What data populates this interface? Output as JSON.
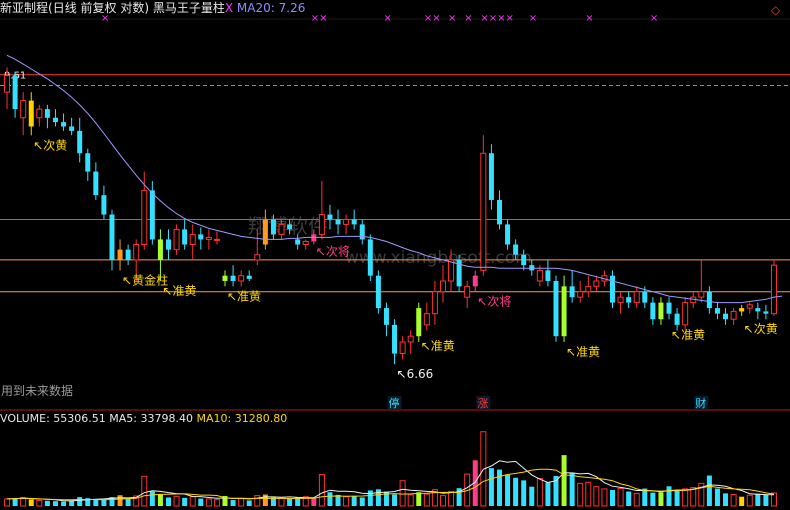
{
  "header": {
    "title": "新亚制程",
    "mode": "(日线 前复权 对数)",
    "indicator": "黑马王子量柱",
    "close_mark": "X",
    "ma20_label": "MA20:",
    "ma20_value": "7.26"
  },
  "volume_header": {
    "volume_label": "VOLUME:",
    "volume_value": "55306.51",
    "ma5_label": "MA5:",
    "ma5_value": "33798.40",
    "ma10_label": "MA10:",
    "ma10_value": "31280.80"
  },
  "watermark": {
    "cn": "翔博软件",
    "url": "www.xiangbosoft.com"
  },
  "footnote": "用到未来数据",
  "colors": {
    "up": "#ff3232",
    "down": "#33e0ff",
    "ma20": "#9b9bff",
    "hline_red": "#ff3c3c",
    "hline_green": "#2ed060",
    "hline_orange": "#ff9a50",
    "yellow": "#ffd700",
    "label_white": "#f0f0f0"
  },
  "chart_data": [
    {
      "type": "candlestick",
      "title": "新亚制程(日线 前复权 对数)",
      "indicator": "黑马王子量柱",
      "ma": {
        "name": "MA20",
        "last": 7.26
      },
      "price_range": [
        6.3,
        10.3
      ],
      "reference_levels": [
        {
          "value": 9.61,
          "label": "9.61",
          "color": "#ff3c3c"
        },
        {
          "value": 9.48,
          "color": "#2ed060",
          "style": "dashed"
        },
        {
          "value": 8.0,
          "color": "#ff3c3c"
        },
        {
          "value": 7.6,
          "color": "#ff9a50"
        },
        {
          "value": 7.3,
          "color": "#ff9a50"
        }
      ],
      "candles": [
        {
          "o": 9.4,
          "h": 9.7,
          "l": 9.2,
          "c": 9.6
        },
        {
          "o": 9.6,
          "h": 9.65,
          "l": 9.1,
          "c": 9.2
        },
        {
          "o": 9.1,
          "h": 9.4,
          "l": 8.9,
          "c": 9.3
        },
        {
          "o": 9.3,
          "h": 9.4,
          "l": 8.9,
          "c": 9.0,
          "special": "yellow"
        },
        {
          "o": 9.1,
          "h": 9.25,
          "l": 9.0,
          "c": 9.2
        },
        {
          "o": 9.2,
          "h": 9.25,
          "l": 8.98,
          "c": 9.1
        },
        {
          "o": 9.1,
          "h": 9.2,
          "l": 9.0,
          "c": 9.05
        },
        {
          "o": 9.05,
          "h": 9.15,
          "l": 8.95,
          "c": 9.0
        },
        {
          "o": 9.0,
          "h": 9.1,
          "l": 8.9,
          "c": 8.95
        },
        {
          "o": 8.95,
          "h": 9.1,
          "l": 8.6,
          "c": 8.7
        },
        {
          "o": 8.7,
          "h": 8.75,
          "l": 8.4,
          "c": 8.5
        },
        {
          "o": 8.5,
          "h": 8.6,
          "l": 8.2,
          "c": 8.25
        },
        {
          "o": 8.25,
          "h": 8.35,
          "l": 8.0,
          "c": 8.05
        },
        {
          "o": 8.05,
          "h": 8.1,
          "l": 7.5,
          "c": 7.6
        },
        {
          "o": 7.6,
          "h": 7.8,
          "l": 7.5,
          "c": 7.7,
          "special": "orange"
        },
        {
          "o": 7.7,
          "h": 7.75,
          "l": 7.55,
          "c": 7.6
        },
        {
          "o": 7.6,
          "h": 7.8,
          "l": 7.4,
          "c": 7.75
        },
        {
          "o": 7.75,
          "h": 8.5,
          "l": 7.7,
          "c": 8.3
        },
        {
          "o": 8.3,
          "h": 8.4,
          "l": 7.75,
          "c": 7.8
        },
        {
          "o": 7.6,
          "h": 7.9,
          "l": 7.4,
          "c": 7.8,
          "special": "lime"
        },
        {
          "o": 7.8,
          "h": 7.9,
          "l": 7.6,
          "c": 7.7
        },
        {
          "o": 7.7,
          "h": 7.95,
          "l": 7.65,
          "c": 7.9
        },
        {
          "o": 7.9,
          "h": 8.0,
          "l": 7.7,
          "c": 7.75
        },
        {
          "o": 7.75,
          "h": 7.95,
          "l": 7.6,
          "c": 7.85
        },
        {
          "o": 7.85,
          "h": 7.92,
          "l": 7.7,
          "c": 7.8
        },
        {
          "o": 7.8,
          "h": 7.9,
          "l": 7.7,
          "c": 7.82
        },
        {
          "o": 7.8,
          "h": 7.88,
          "l": 7.75,
          "c": 7.8
        },
        {
          "o": 7.4,
          "h": 7.5,
          "l": 7.35,
          "c": 7.45,
          "special": "lime"
        },
        {
          "o": 7.45,
          "h": 7.55,
          "l": 7.35,
          "c": 7.4
        },
        {
          "o": 7.4,
          "h": 7.5,
          "l": 7.35,
          "c": 7.45
        },
        {
          "o": 7.45,
          "h": 7.5,
          "l": 7.4,
          "c": 7.42
        },
        {
          "o": 7.6,
          "h": 7.9,
          "l": 7.55,
          "c": 7.65
        },
        {
          "o": 7.75,
          "h": 8.1,
          "l": 7.7,
          "c": 8.0,
          "special": "orange"
        },
        {
          "o": 8.0,
          "h": 8.05,
          "l": 7.8,
          "c": 7.85
        },
        {
          "o": 7.85,
          "h": 8.0,
          "l": 7.8,
          "c": 7.95
        },
        {
          "o": 7.95,
          "h": 8.0,
          "l": 7.85,
          "c": 7.9
        },
        {
          "o": 7.8,
          "h": 7.85,
          "l": 7.7,
          "c": 7.75
        },
        {
          "o": 7.75,
          "h": 7.8,
          "l": 7.7,
          "c": 7.78
        },
        {
          "o": 7.78,
          "h": 7.9,
          "l": 7.75,
          "c": 7.85,
          "special": "pink"
        },
        {
          "o": 7.85,
          "h": 8.4,
          "l": 7.8,
          "c": 8.05
        },
        {
          "o": 8.05,
          "h": 8.15,
          "l": 7.9,
          "c": 8.0
        },
        {
          "o": 8.0,
          "h": 8.1,
          "l": 7.85,
          "c": 7.95
        },
        {
          "o": 7.95,
          "h": 8.05,
          "l": 7.85,
          "c": 8.0
        },
        {
          "o": 8.0,
          "h": 8.1,
          "l": 7.9,
          "c": 7.95
        },
        {
          "o": 7.95,
          "h": 8.0,
          "l": 7.75,
          "c": 7.8
        },
        {
          "o": 7.8,
          "h": 7.85,
          "l": 7.4,
          "c": 7.45
        },
        {
          "o": 7.45,
          "h": 7.5,
          "l": 7.1,
          "c": 7.15
        },
        {
          "o": 7.15,
          "h": 7.2,
          "l": 6.9,
          "c": 7.0
        },
        {
          "o": 7.0,
          "h": 7.05,
          "l": 6.66,
          "c": 6.75
        },
        {
          "o": 6.75,
          "h": 6.9,
          "l": 6.7,
          "c": 6.85
        },
        {
          "o": 6.85,
          "h": 6.95,
          "l": 6.75,
          "c": 6.9
        },
        {
          "o": 6.9,
          "h": 7.2,
          "l": 6.85,
          "c": 7.15,
          "special": "lime"
        },
        {
          "o": 7.0,
          "h": 7.2,
          "l": 6.95,
          "c": 7.1
        },
        {
          "o": 7.1,
          "h": 7.4,
          "l": 7.0,
          "c": 7.3
        },
        {
          "o": 7.3,
          "h": 7.55,
          "l": 7.2,
          "c": 7.4
        },
        {
          "o": 7.4,
          "h": 7.7,
          "l": 7.3,
          "c": 7.6
        },
        {
          "o": 7.6,
          "h": 7.65,
          "l": 7.3,
          "c": 7.35
        },
        {
          "o": 7.25,
          "h": 7.4,
          "l": 7.15,
          "c": 7.35
        },
        {
          "o": 7.35,
          "h": 7.5,
          "l": 7.3,
          "c": 7.45,
          "special": "pink"
        },
        {
          "o": 7.5,
          "h": 8.9,
          "l": 7.45,
          "c": 8.7
        },
        {
          "o": 8.7,
          "h": 8.8,
          "l": 8.1,
          "c": 8.2
        },
        {
          "o": 8.2,
          "h": 8.3,
          "l": 7.9,
          "c": 7.95
        },
        {
          "o": 7.95,
          "h": 8.0,
          "l": 7.7,
          "c": 7.75
        },
        {
          "o": 7.75,
          "h": 7.8,
          "l": 7.6,
          "c": 7.65
        },
        {
          "o": 7.65,
          "h": 7.7,
          "l": 7.5,
          "c": 7.55
        },
        {
          "o": 7.55,
          "h": 7.6,
          "l": 7.45,
          "c": 7.5
        },
        {
          "o": 7.4,
          "h": 7.55,
          "l": 7.35,
          "c": 7.5
        },
        {
          "o": 7.5,
          "h": 7.6,
          "l": 7.35,
          "c": 7.4
        },
        {
          "o": 7.4,
          "h": 7.45,
          "l": 6.85,
          "c": 6.9
        },
        {
          "o": 6.9,
          "h": 7.45,
          "l": 6.85,
          "c": 7.35,
          "special": "lime"
        },
        {
          "o": 7.35,
          "h": 7.5,
          "l": 7.2,
          "c": 7.25
        },
        {
          "o": 7.25,
          "h": 7.4,
          "l": 7.2,
          "c": 7.3
        },
        {
          "o": 7.3,
          "h": 7.45,
          "l": 7.25,
          "c": 7.35
        },
        {
          "o": 7.35,
          "h": 7.45,
          "l": 7.3,
          "c": 7.4
        },
        {
          "o": 7.4,
          "h": 7.5,
          "l": 7.35,
          "c": 7.45
        },
        {
          "o": 7.45,
          "h": 7.5,
          "l": 7.15,
          "c": 7.2
        },
        {
          "o": 7.2,
          "h": 7.3,
          "l": 7.1,
          "c": 7.25
        },
        {
          "o": 7.25,
          "h": 7.3,
          "l": 7.15,
          "c": 7.2
        },
        {
          "o": 7.2,
          "h": 7.35,
          "l": 7.15,
          "c": 7.3
        },
        {
          "o": 7.3,
          "h": 7.35,
          "l": 7.15,
          "c": 7.2
        },
        {
          "o": 7.2,
          "h": 7.25,
          "l": 7.0,
          "c": 7.05
        },
        {
          "o": 7.05,
          "h": 7.25,
          "l": 7.0,
          "c": 7.2,
          "special": "lime"
        },
        {
          "o": 7.2,
          "h": 7.25,
          "l": 7.05,
          "c": 7.1
        },
        {
          "o": 7.1,
          "h": 7.15,
          "l": 6.95,
          "c": 7.0
        },
        {
          "o": 7.0,
          "h": 7.25,
          "l": 6.95,
          "c": 7.2
        },
        {
          "o": 7.2,
          "h": 7.3,
          "l": 7.15,
          "c": 7.25
        },
        {
          "o": 7.25,
          "h": 7.6,
          "l": 7.2,
          "c": 7.3
        },
        {
          "o": 7.3,
          "h": 7.35,
          "l": 7.1,
          "c": 7.15
        },
        {
          "o": 7.15,
          "h": 7.2,
          "l": 7.05,
          "c": 7.1
        },
        {
          "o": 7.1,
          "h": 7.15,
          "l": 7.0,
          "c": 7.05
        },
        {
          "o": 7.05,
          "h": 7.15,
          "l": 7.0,
          "c": 7.12
        },
        {
          "o": 7.12,
          "h": 7.18,
          "l": 7.08,
          "c": 7.15,
          "special": "yellow"
        },
        {
          "o": 7.15,
          "h": 7.2,
          "l": 7.1,
          "c": 7.18
        },
        {
          "o": 7.15,
          "h": 7.2,
          "l": 7.05,
          "c": 7.12
        },
        {
          "o": 7.12,
          "h": 7.18,
          "l": 7.05,
          "c": 7.1
        },
        {
          "o": 7.1,
          "h": 7.6,
          "l": 7.08,
          "c": 7.55
        }
      ],
      "ma20": [
        9.85,
        9.8,
        9.74,
        9.68,
        9.62,
        9.56,
        9.49,
        9.42,
        9.34,
        9.25,
        9.15,
        9.04,
        8.92,
        8.8,
        8.68,
        8.57,
        8.46,
        8.36,
        8.27,
        8.19,
        8.12,
        8.06,
        8.01,
        7.97,
        7.94,
        7.91,
        7.89,
        7.87,
        7.85,
        7.83,
        7.82,
        7.81,
        7.8,
        7.8,
        7.8,
        7.81,
        7.81,
        7.82,
        7.82,
        7.82,
        7.82,
        7.83,
        7.83,
        7.83,
        7.83,
        7.82,
        7.8,
        7.78,
        7.75,
        7.72,
        7.69,
        7.67,
        7.64,
        7.62,
        7.6,
        7.58,
        7.56,
        7.54,
        7.53,
        7.53,
        7.53,
        7.52,
        7.52,
        7.52,
        7.52,
        7.52,
        7.52,
        7.52,
        7.52,
        7.51,
        7.5,
        7.48,
        7.46,
        7.44,
        7.42,
        7.4,
        7.38,
        7.36,
        7.34,
        7.32,
        7.3,
        7.28,
        7.26,
        7.25,
        7.24,
        7.23,
        7.22,
        7.21,
        7.2,
        7.2,
        7.2,
        7.2,
        7.21,
        7.22,
        7.23,
        7.25,
        7.26
      ],
      "volume": [
        1900,
        2100,
        2300,
        1800,
        1500,
        1400,
        1300,
        1200,
        1500,
        2400,
        2100,
        1900,
        1700,
        2400,
        2900,
        1900,
        2700,
        8000,
        3900,
        3200,
        2300,
        2600,
        2200,
        2500,
        2000,
        1900,
        1700,
        2700,
        1600,
        2000,
        1500,
        2800,
        3100,
        2300,
        2100,
        1900,
        2400,
        2500,
        2200,
        8500,
        3700,
        3000,
        2500,
        2700,
        2300,
        4200,
        4500,
        3900,
        3100,
        6800,
        3000,
        3700,
        3200,
        4400,
        2800,
        3900,
        4800,
        8600,
        12300,
        20000,
        10200,
        9800,
        8400,
        7600,
        6900,
        5200,
        7400,
        6400,
        8100,
        13700,
        9000,
        6100,
        6400,
        5200,
        4600,
        4300,
        4700,
        3900,
        3400,
        4700,
        3600,
        3700,
        5300,
        4200,
        4600,
        5000,
        6100,
        8200,
        4700,
        3400,
        3100,
        2500,
        2900,
        3300,
        3000,
        3500
      ],
      "volume_ma5": [
        1900,
        2000,
        2100,
        2025,
        1920,
        1820,
        1660,
        1440,
        1380,
        1560,
        1700,
        1820,
        1920,
        2100,
        2200,
        2180,
        2320,
        3580,
        4080,
        3940,
        3600,
        3340,
        3240,
        2560,
        2520,
        2300,
        2060,
        2160,
        2100,
        2040,
        1900,
        2120,
        2440,
        2440,
        2360,
        2440,
        2320,
        2240,
        2220,
        3500,
        4260,
        3980,
        3980,
        3860,
        3440,
        3340,
        3640,
        3700,
        3900,
        4500,
        4260,
        4100,
        3940,
        3820,
        3420,
        3600,
        3820,
        4940,
        6400,
        9880,
        10800,
        12180,
        11780,
        12000,
        10140,
        8380,
        7220,
        6320,
        6800,
        8960,
        8920,
        8640,
        8780,
        7880,
        6260,
        5320,
        5000,
        4620,
        4160,
        4200,
        4060,
        3860,
        4140,
        4300,
        4280,
        4560,
        5040,
        5660,
        5560,
        5300,
        4660,
        4180,
        3320,
        3160,
        3080,
        3040
      ],
      "volume_ma10": [
        1900,
        2000,
        2100,
        2025,
        1920,
        1833,
        1757,
        1688,
        1667,
        1740,
        1760,
        1740,
        1680,
        1740,
        1880,
        1930,
        2070,
        2750,
        2990,
        3130,
        3170,
        3240,
        3290,
        3130,
        2940,
        2940,
        2840,
        2240,
        2010,
        2090,
        2030,
        2050,
        2070,
        2050,
        2060,
        2000,
        2070,
        2050,
        2080,
        2470,
        2670,
        2690,
        2630,
        2670,
        2690,
        2840,
        3070,
        3220,
        3330,
        3200,
        3250,
        3380,
        3450,
        3620,
        3670,
        3640,
        3670,
        4140,
        5060,
        6620,
        7340,
        7950,
        8470,
        8790,
        9120,
        9660,
        9920,
        9900,
        9660,
        8350,
        8230,
        7860,
        7660,
        7420,
        7190,
        6810,
        5950,
        5470,
        4600,
        4140,
        4060,
        4020,
        4100,
        4150,
        4200,
        4450,
        4880,
        5310,
        5010,
        4760,
        4610,
        4490,
        4350,
        4020,
        3520,
        3200
      ],
      "signals": [
        {
          "index": 3,
          "text": "次黄",
          "color": "#ffd700",
          "pos": "below",
          "price": 8.9
        },
        {
          "index": 14,
          "text": "黄金柱",
          "color": "#ffd700",
          "pos": "below",
          "price": 7.5
        },
        {
          "index": 19,
          "text": "准黄",
          "color": "#ffd700",
          "pos": "below",
          "price": 7.4
        },
        {
          "index": 27,
          "text": "准黄",
          "color": "#ffd700",
          "pos": "below",
          "price": 7.35
        },
        {
          "index": 38,
          "text": "次将",
          "color": "#ff3c8a",
          "pos": "below",
          "price": 7.78
        },
        {
          "index": 48,
          "text": "6.66",
          "color": "#f0f0f0",
          "pos": "below",
          "price": 6.66
        },
        {
          "index": 51,
          "text": "准黄",
          "color": "#ffd700",
          "pos": "below",
          "price": 6.9
        },
        {
          "index": 58,
          "text": "次将",
          "color": "#ff3c8a",
          "pos": "below",
          "price": 7.3
        },
        {
          "index": 69,
          "text": "准黄",
          "color": "#ffd700",
          "pos": "below",
          "price": 6.85
        },
        {
          "index": 82,
          "text": "准黄",
          "color": "#ffd700",
          "pos": "below",
          "price": 7.0
        },
        {
          "index": 91,
          "text": "次黄",
          "color": "#ffd700",
          "pos": "below",
          "price": 7.05
        }
      ],
      "tags": [
        {
          "index": 48,
          "text": "停",
          "color": "#33e0ff"
        },
        {
          "index": 59,
          "text": "涨",
          "color": "#ff3c3c"
        },
        {
          "index": 86,
          "text": "财",
          "color": "#33e0ff"
        }
      ],
      "top_markers": [
        {
          "index": 12,
          "text": "×"
        },
        {
          "index": 38,
          "text": "××"
        },
        {
          "index": 47,
          "text": "×"
        },
        {
          "index": 52,
          "text": "××"
        },
        {
          "index": 55,
          "text": "×"
        },
        {
          "index": 57,
          "text": "×"
        },
        {
          "index": 59,
          "text": "××××"
        },
        {
          "index": 65,
          "text": "×"
        },
        {
          "index": 72,
          "text": "×"
        },
        {
          "index": 80,
          "text": "×"
        }
      ],
      "corner_mark": "◇"
    }
  ]
}
